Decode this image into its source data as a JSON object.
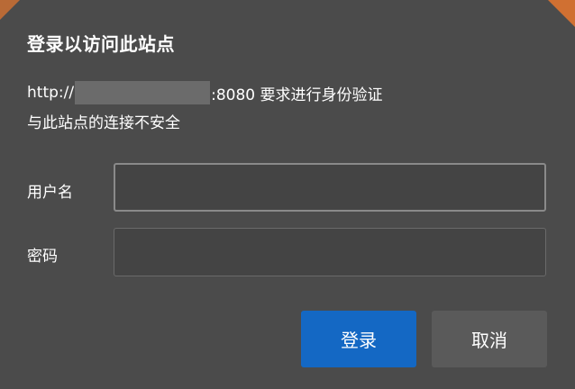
{
  "dialog": {
    "title": "登录以访问此站点",
    "url_prefix": "http://",
    "url_suffix": ":8080 要求进行身份验证",
    "security_notice": "与此站点的连接不安全",
    "username_label": "用户名",
    "password_label": "密码",
    "username_value": "",
    "password_value": "",
    "login_button": "登录",
    "cancel_button": "取消"
  },
  "colors": {
    "background": "#4b4b4b",
    "primary_button": "#1468c4",
    "secondary_button": "#5a5a5a"
  }
}
